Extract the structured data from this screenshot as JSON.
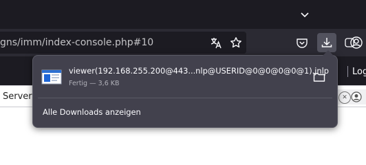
{
  "titlebar": {
    "chevron_icon": "chevron-down-icon"
  },
  "urlbar": {
    "url": "gns/imm/index-console.php#10",
    "icons": [
      "translate-icon",
      "bookmark-star-icon"
    ]
  },
  "toolbar": {
    "icons": [
      "pocket-icon",
      "download-icon",
      "extensions-icon",
      "account-icon"
    ],
    "active": "download-icon",
    "accent": "#52525e"
  },
  "bookmarks_bar": {
    "right_text": "Log"
  },
  "page": {
    "tab_text": "Server N"
  },
  "downloads_panel": {
    "items": [
      {
        "filename": "viewer(192.168.255.200@443...nlp@USERID@0@0@0@0@1).jnlp",
        "status": "Fertig — 3,6 KB",
        "icon": "file-icon",
        "action_icon": "folder-icon"
      }
    ],
    "show_all_label": "Alle Downloads anzeigen",
    "background": "#42414d"
  }
}
